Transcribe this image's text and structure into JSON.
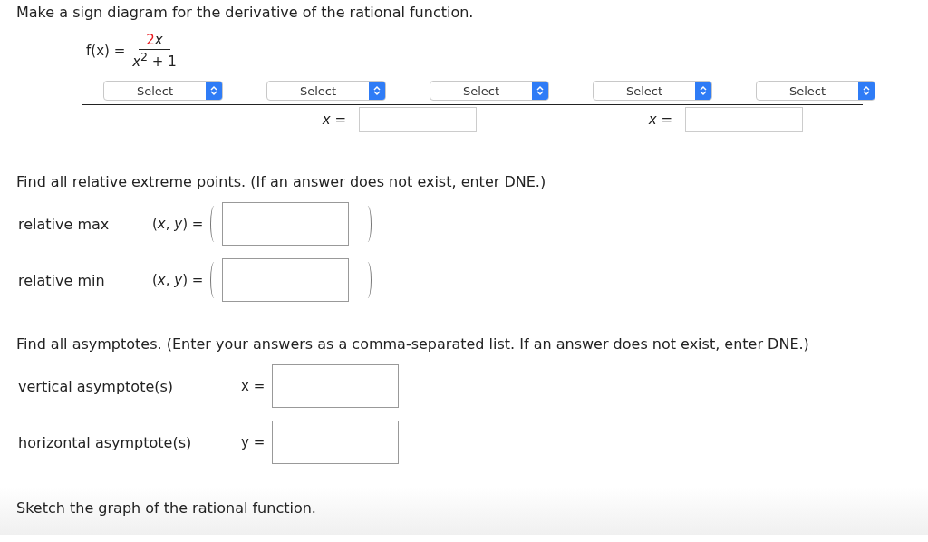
{
  "prompt": "Make a sign diagram for the derivative of the rational function.",
  "function": {
    "lhs": "f(x) =",
    "numerator_coefficient": "2",
    "numerator_variable": "x",
    "denominator": "*x*$^{2}$ + 1"
  },
  "sign_diagram": {
    "selects": [
      {
        "value": "---Select---"
      },
      {
        "value": "---Select---"
      },
      {
        "value": "---Select---"
      },
      {
        "value": "---Select---"
      },
      {
        "value": "---Select---"
      }
    ],
    "points": [
      {
        "label": "x ="
      },
      {
        "label": "x ="
      }
    ]
  },
  "extrema_prompt": "Find all relative extreme points. (If an answer does not exist, enter DNE.)",
  "extrema": [
    {
      "label": "relative max",
      "equation": "(*x*, *y*) ="
    },
    {
      "label": "relative min",
      "equation": "(*x*, *y*) ="
    }
  ],
  "asymptote_prompt": "Find all asymptotes. (Enter your answers as a comma-separated list. If an answer does not exist, enter DNE.)",
  "asymptotes": [
    {
      "label": "vertical asymptote(s)",
      "variable": "x ="
    },
    {
      "label": "horizontal asymptote(s)",
      "variable": "y ="
    }
  ],
  "sketch_prompt": "Sketch the graph of the rational function."
}
